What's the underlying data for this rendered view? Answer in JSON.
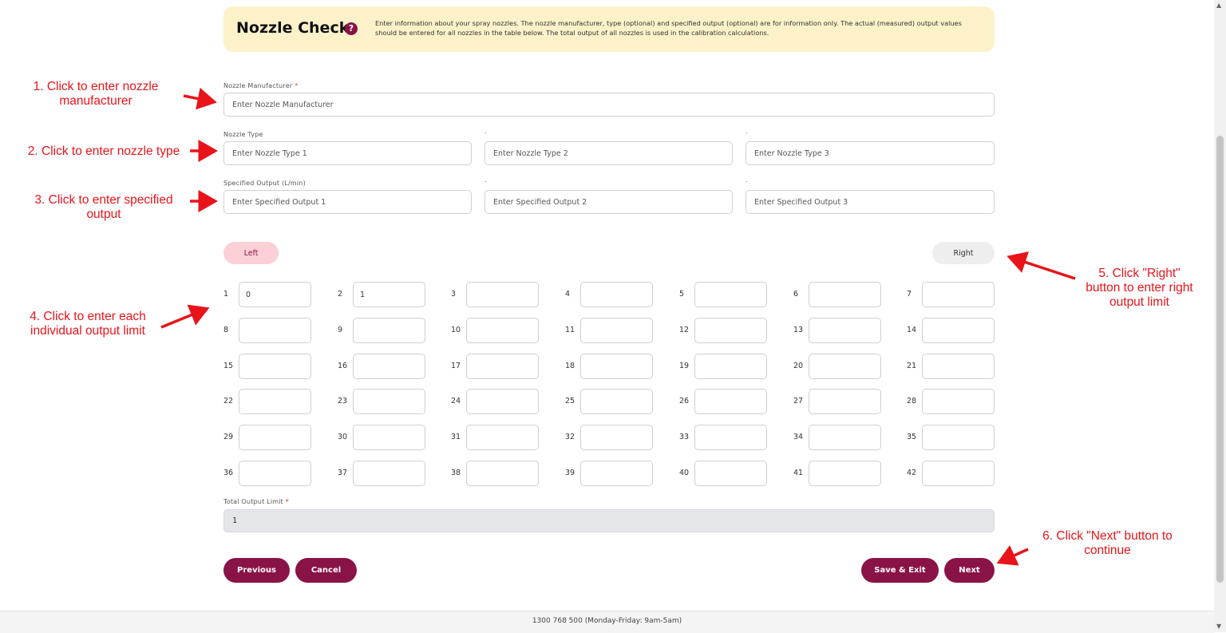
{
  "header": {
    "title": "Nozzle Check",
    "help_icon": "?",
    "description": "Enter information about your spray nozzles. The nozzle manufacturer, type (optional) and specified output (optional) are for information only. The actual (measured) output values should be entered for all nozzles in the table below. The total output of all nozzles is used in the calibration calculations."
  },
  "form": {
    "manufacturer_label": "Nozzle Manufacturer",
    "required_mark": "*",
    "manufacturer_placeholder": "Enter Nozzle Manufacturer",
    "type_label": "Nozzle Type",
    "type_placeholders": [
      "Enter Nozzle Type 1",
      "Enter Nozzle Type 2",
      "Enter Nozzle Type 3"
    ],
    "output_label": "Specified Output (L/min)",
    "output_placeholders": [
      "Enter Specified Output 1",
      "Enter Specified Output 2",
      "Enter Specified Output 3"
    ],
    "dot": "."
  },
  "sides": {
    "left": "Left",
    "right": "Right",
    "active": "Left"
  },
  "nozzles": {
    "count": 42,
    "values": {
      "1": "0",
      "2": "1"
    }
  },
  "total": {
    "label": "Total Output Limit",
    "value": "1"
  },
  "buttons": {
    "previous": "Previous",
    "cancel": "Cancel",
    "save_exit": "Save & Exit",
    "next": "Next"
  },
  "footer": {
    "contact": "1300 768 500 (Monday-Friday: 9am-5am)"
  },
  "annotations": {
    "a1": "1. Click to enter nozzle\nmanufacturer",
    "a2": "2. Click to enter nozzle type",
    "a3": "3. Click to enter specified\noutput",
    "a4": "4. Click to enter each\nindividual output limit",
    "a5": "5. Click \"Right\"\nbutton to enter right\noutput limit",
    "a6": "6. Click \"Next\" button to\ncontinue"
  },
  "colors": {
    "brand": "#8a1346",
    "header_bg": "#fdf1c9",
    "annotation": "#e8141a",
    "left_active": "#fbd0d6"
  }
}
